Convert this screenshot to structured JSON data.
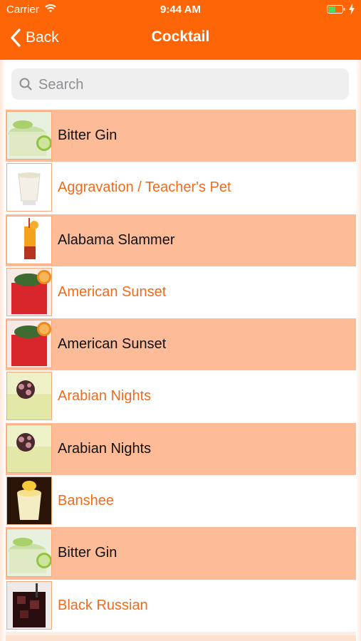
{
  "status_bar": {
    "carrier": "Carrier",
    "time": "9:44 AM"
  },
  "nav": {
    "back_label": "Back",
    "title": "Cocktail"
  },
  "search": {
    "placeholder": "Search",
    "value": ""
  },
  "colors": {
    "accent": "#fd6506",
    "row_alt": "#fdbb97",
    "link": "#f26a1b"
  },
  "cocktails": [
    {
      "name": "Bitter Gin",
      "thumb": "lime-drink"
    },
    {
      "name": "Aggravation / Teacher's Pet",
      "thumb": "cream-drink"
    },
    {
      "name": "Alabama Slammer",
      "thumb": "tall-orange-drink"
    },
    {
      "name": "American Sunset",
      "thumb": "red-mint-drink"
    },
    {
      "name": "American Sunset",
      "thumb": "red-mint-drink"
    },
    {
      "name": "Arabian Nights",
      "thumb": "flower-slush-drink"
    },
    {
      "name": "Arabian Nights",
      "thumb": "flower-slush-drink"
    },
    {
      "name": "Banshee",
      "thumb": "banana-cream-drink"
    },
    {
      "name": "Bitter Gin",
      "thumb": "lime-drink"
    },
    {
      "name": "Black Russian",
      "thumb": "dark-ice-drink"
    }
  ]
}
